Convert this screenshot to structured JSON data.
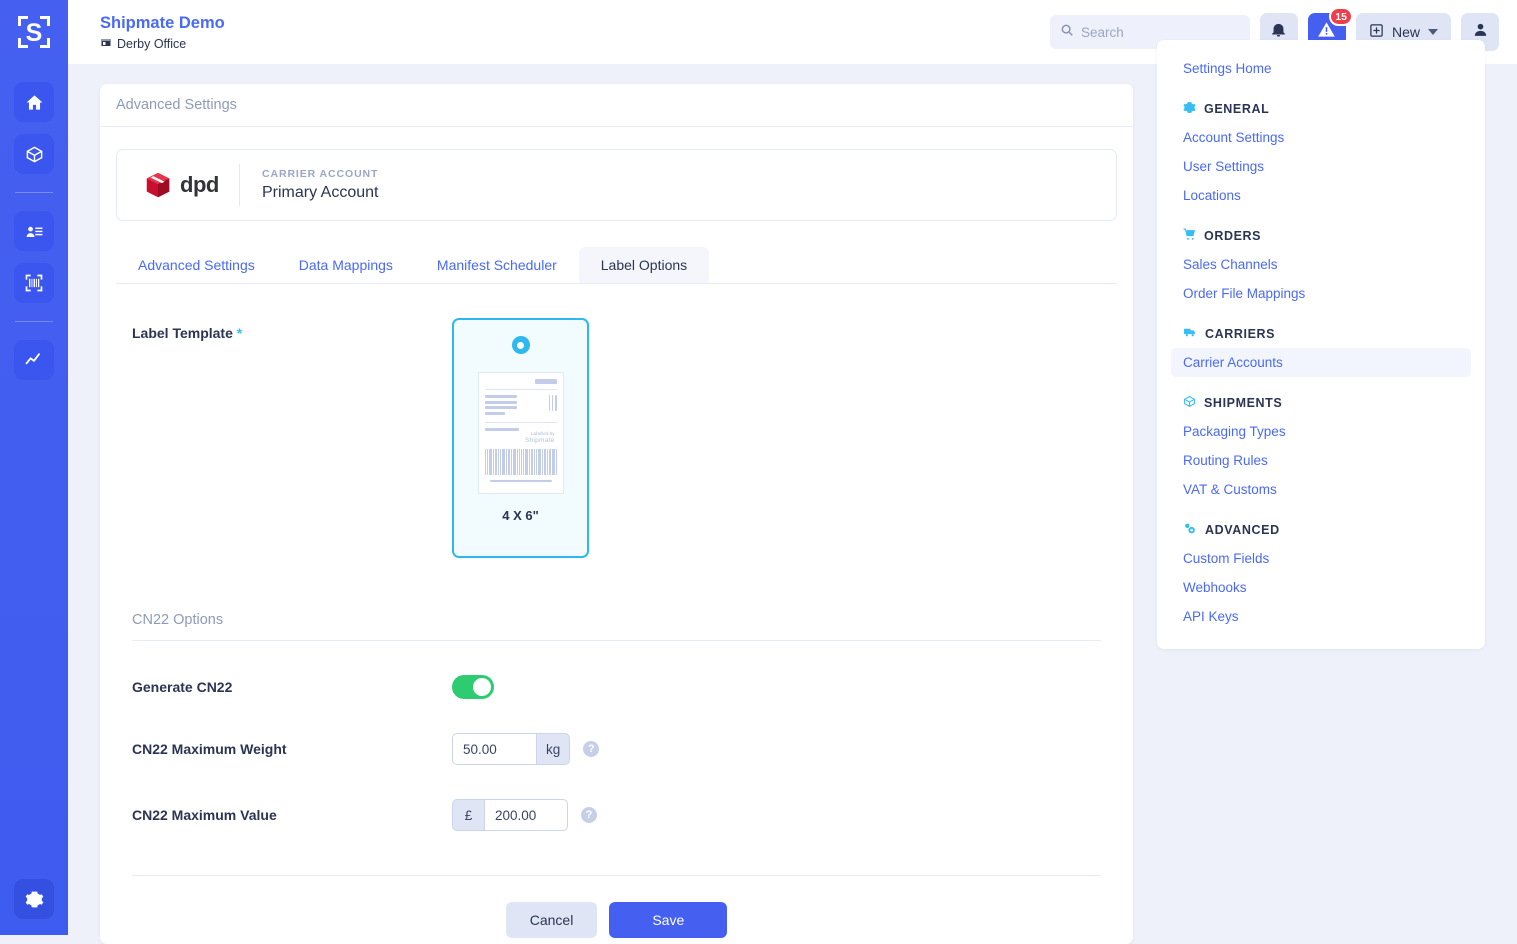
{
  "rail": {
    "logo": "shipmate-logo",
    "items": [
      {
        "icon": "home-icon",
        "name": "home"
      },
      {
        "icon": "box-icon",
        "name": "shipments"
      },
      {
        "icon": "address-book-icon",
        "name": "contacts"
      },
      {
        "icon": "barcode-scan-icon",
        "name": "scan"
      },
      {
        "icon": "chart-line-icon",
        "name": "analytics"
      }
    ],
    "bottom": {
      "icon": "gear-icon",
      "name": "settings"
    }
  },
  "topbar": {
    "brand_title": "Shipmate Demo",
    "brand_sub": "Derby Office",
    "search_placeholder": "Search",
    "search_value": "",
    "slash_key": "/",
    "notifications_icon": "bell-icon",
    "alert_icon": "warning-icon",
    "alert_badge": "15",
    "new_label": "New",
    "new_icon": "plus-square-icon",
    "account_icon": "user-icon"
  },
  "main": {
    "header_title": "Advanced Settings",
    "carrier": {
      "logo_text": "dpd",
      "label": "CARRIER ACCOUNT",
      "value": "Primary Account"
    },
    "tabs": [
      {
        "label": "Advanced Settings",
        "active": false
      },
      {
        "label": "Data Mappings",
        "active": false
      },
      {
        "label": "Manifest Scheduler",
        "active": false
      },
      {
        "label": "Label Options",
        "active": true
      }
    ],
    "label_template": {
      "field_label": "Label Template",
      "required_mark": "*",
      "option_caption": "4 X 6\"",
      "mock_brand_top": "Labelled by",
      "mock_brand_name": "Shipmate",
      "selected": true
    },
    "cn22": {
      "section_title": "CN22 Options",
      "generate": {
        "label": "Generate CN22",
        "enabled": true
      },
      "max_weight": {
        "label": "CN22 Maximum Weight",
        "value": "50.00",
        "unit": "kg",
        "help": "?"
      },
      "max_value": {
        "label": "CN22 Maximum Value",
        "value": "200.00",
        "currency": "£",
        "help": "?"
      }
    },
    "actions": {
      "cancel": "Cancel",
      "save": "Save"
    }
  },
  "sidebar": {
    "top_link": "Settings Home",
    "sections": [
      {
        "title": "GENERAL",
        "icon": "gear-icon",
        "items": [
          {
            "label": "Account Settings",
            "active": false
          },
          {
            "label": "User Settings",
            "active": false
          },
          {
            "label": "Locations",
            "active": false
          }
        ]
      },
      {
        "title": "ORDERS",
        "icon": "cart-icon",
        "items": [
          {
            "label": "Sales Channels",
            "active": false
          },
          {
            "label": "Order File Mappings",
            "active": false
          }
        ]
      },
      {
        "title": "CARRIERS",
        "icon": "truck-icon",
        "items": [
          {
            "label": "Carrier Accounts",
            "active": true
          }
        ]
      },
      {
        "title": "SHIPMENTS",
        "icon": "box-icon",
        "items": [
          {
            "label": "Packaging Types",
            "active": false
          },
          {
            "label": "Routing Rules",
            "active": false
          },
          {
            "label": "VAT & Customs",
            "active": false
          }
        ]
      },
      {
        "title": "ADVANCED",
        "icon": "cogs-icon",
        "items": [
          {
            "label": "Custom Fields",
            "active": false
          },
          {
            "label": "Webhooks",
            "active": false
          },
          {
            "label": "API Keys",
            "active": false
          }
        ]
      }
    ]
  },
  "colors": {
    "brand_blue": "#4560f0",
    "accent_cyan": "#2fb8ee",
    "toggle_green": "#2ecc71",
    "badge_red": "#ef3e4a",
    "dpd_red": "#c8102e"
  }
}
